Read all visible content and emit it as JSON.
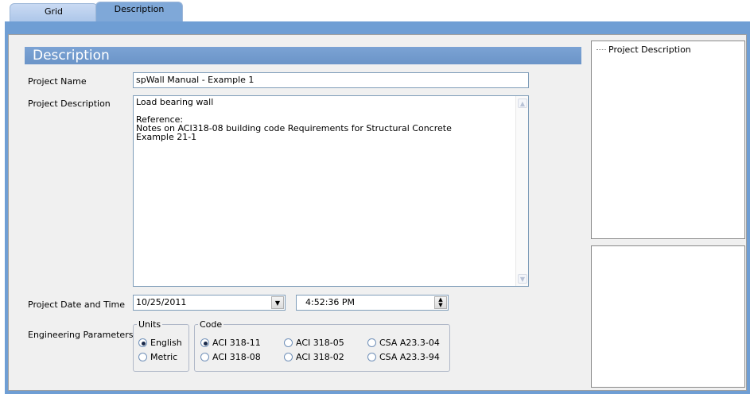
{
  "tabs": [
    {
      "label": "Grid",
      "active": false
    },
    {
      "label": "Description",
      "active": true
    }
  ],
  "section_title": "Description",
  "form": {
    "project_name_label": "Project Name",
    "project_name_value": "spWall Manual - Example 1",
    "project_description_label": "Project Description",
    "project_description_value": "Load bearing wall\n\nReference:\nNotes on ACI318-08 building code Requirements for Structural Concrete\nExample 21-1",
    "date_time_label": "Project Date and Time",
    "date_value": "10/25/2011",
    "time_value": "4:52:36 PM",
    "engineering_params_label": "Engineering Parameters"
  },
  "units": {
    "legend": "Units",
    "options": [
      {
        "label": "English",
        "selected": true
      },
      {
        "label": "Metric",
        "selected": false
      }
    ]
  },
  "code": {
    "legend": "Code",
    "options": [
      {
        "label": "ACI 318-11",
        "selected": true
      },
      {
        "label": "ACI 318-05",
        "selected": false
      },
      {
        "label": "CSA A23.3-04",
        "selected": false
      },
      {
        "label": "ACI 318-08",
        "selected": false
      },
      {
        "label": "ACI 318-02",
        "selected": false
      },
      {
        "label": "CSA A23.3-94",
        "selected": false
      }
    ]
  },
  "tree": {
    "items": [
      "Project Description"
    ]
  },
  "colors": {
    "accent": "#6f9ed4",
    "title_bar": "#7ba3d4"
  }
}
